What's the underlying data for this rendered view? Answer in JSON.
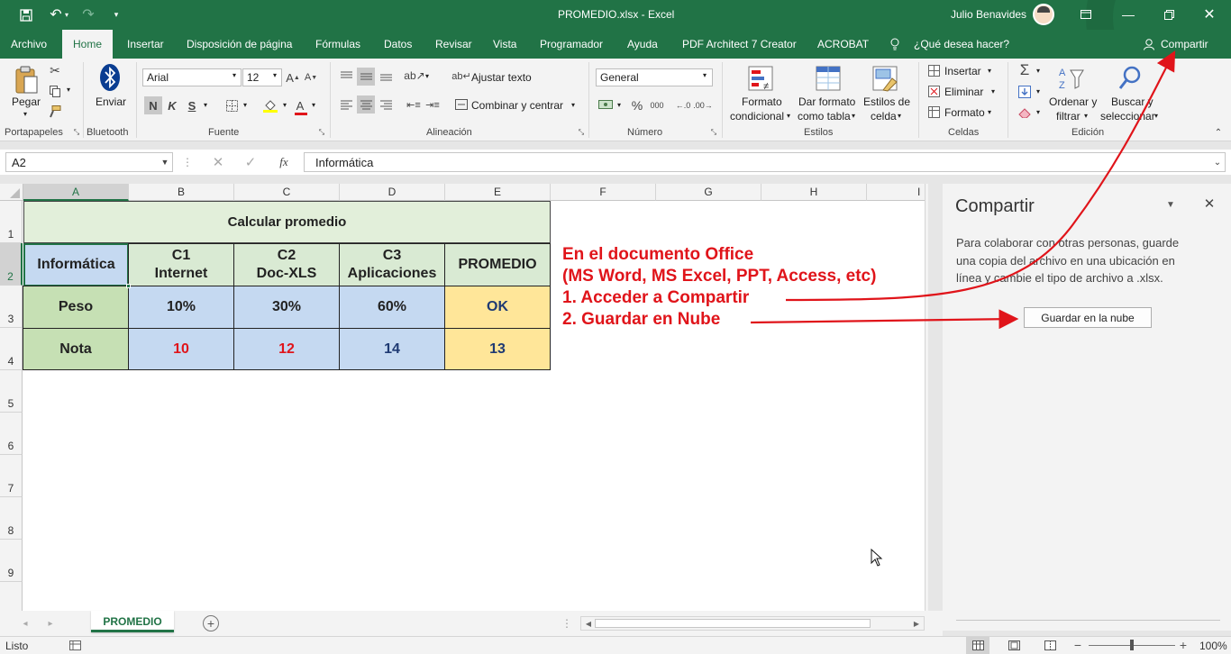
{
  "titlebar": {
    "filename": "PROMEDIO.xlsx  -  Excel",
    "user": "Julio Benavides"
  },
  "menu": [
    {
      "label": "Archivo"
    },
    {
      "label": "Home"
    },
    {
      "label": "Insertar"
    },
    {
      "label": "Disposición de página"
    },
    {
      "label": "Fórmulas"
    },
    {
      "label": "Datos"
    },
    {
      "label": "Revisar"
    },
    {
      "label": "Vista"
    },
    {
      "label": "Programador"
    },
    {
      "label": "Ayuda"
    },
    {
      "label": "PDF Architect 7 Creator"
    },
    {
      "label": "ACROBAT"
    },
    {
      "label": "¿Qué desea hacer?"
    },
    {
      "label": "Compartir"
    }
  ],
  "ribbon": {
    "paste": "Pegar",
    "send": "Enviar",
    "font": "Arial",
    "size": "12",
    "bold": "N",
    "italic": "K",
    "underline": "S",
    "wrap": "Ajustar texto",
    "merge": "Combinar y centrar",
    "numfmt": "General",
    "percent": "%",
    "thousands": "000",
    "cond1": "Formato",
    "cond2": "condicional",
    "table1": "Dar formato",
    "table2": "como tabla",
    "styles1": "Estilos de",
    "styles2": "celda",
    "insert": "Insertar",
    "delete": "Eliminar",
    "format": "Formato",
    "sort1": "Ordenar y",
    "sort2": "filtrar",
    "find1": "Buscar y",
    "find2": "seleccionar",
    "groups": {
      "clipboard": "Portapapeles",
      "bluetooth": "Bluetooth",
      "font": "Fuente",
      "align": "Alineación",
      "number": "Número",
      "styles": "Estilos",
      "cells": "Celdas",
      "edit": "Edición"
    }
  },
  "formula": {
    "namebox": "A2",
    "fx": "fx",
    "content": "Informática"
  },
  "columns": [
    "A",
    "B",
    "C",
    "D",
    "E",
    "F",
    "G",
    "H",
    "I"
  ],
  "rows": [
    "1",
    "2",
    "3",
    "4",
    "5",
    "6",
    "7",
    "8",
    "9"
  ],
  "table": {
    "title": "Calcular promedio",
    "header": [
      {
        "line1": "Informática",
        "line2": ""
      },
      {
        "line1": "C1",
        "line2": "Internet"
      },
      {
        "line1": "C2",
        "line2": "Doc-XLS"
      },
      {
        "line1": "C3",
        "line2": "Aplicaciones"
      },
      {
        "line1": "PROMEDIO",
        "line2": ""
      }
    ],
    "peso": [
      "Peso",
      "10%",
      "30%",
      "60%",
      "OK"
    ],
    "nota": [
      "Nota",
      "10",
      "12",
      "14",
      "13"
    ]
  },
  "annotation": {
    "line1": "En el documento Office",
    "line2": "(MS Word, MS Excel, PPT, Access, etc)",
    "line3": "1. Acceder a Compartir",
    "line4": "2. Guardar en Nube"
  },
  "share_pane": {
    "title": "Compartir",
    "description_lines": [
      "Para colaborar con otras personas, guarde",
      "una copia del archivo en una ubicación en",
      "línea y cambie el tipo de archivo a .xlsx."
    ],
    "button": "Guardar en la nube"
  },
  "sheet_tab": "PROMEDIO",
  "status": {
    "left": "Listo",
    "zoom": "100%"
  },
  "colors": {
    "excel_green": "#217346",
    "header_green": "#d9ead3",
    "cell_blue": "#c5d9f1",
    "cell_yellow": "#ffe699",
    "annot_red": "#e0141a",
    "value_red": "#e0141a",
    "value_navy": "#1f3a73"
  }
}
